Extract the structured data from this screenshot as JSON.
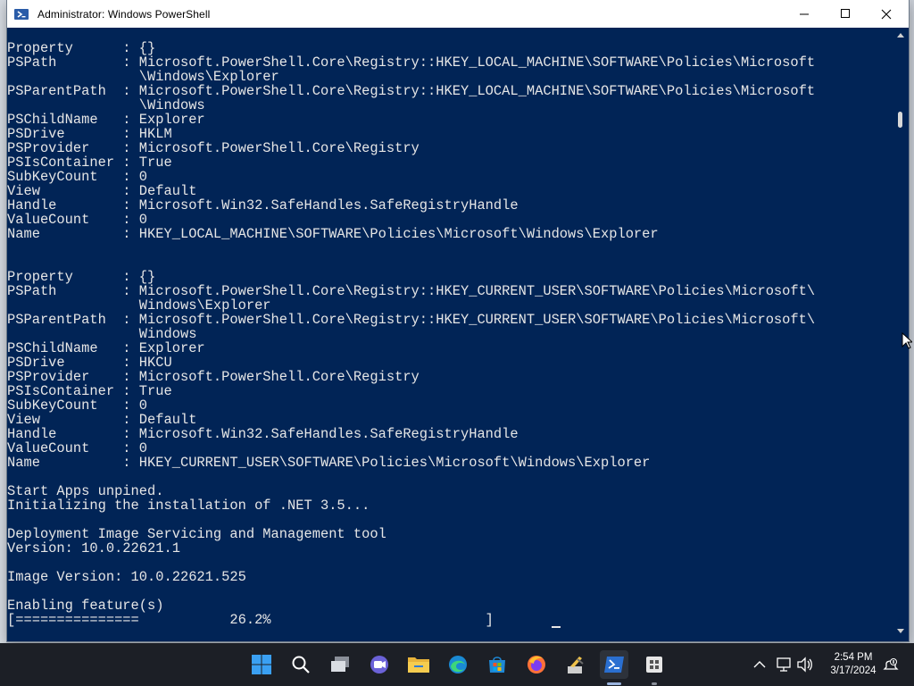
{
  "window": {
    "title": "Administrator: Windows PowerShell",
    "minimize_label": "minimize",
    "maximize_label": "maximize",
    "close_label": "close"
  },
  "console": {
    "lines": [
      "Property      : {}",
      "PSPath        : Microsoft.PowerShell.Core\\Registry::HKEY_LOCAL_MACHINE\\SOFTWARE\\Policies\\Microsoft",
      "                \\Windows\\Explorer",
      "PSParentPath  : Microsoft.PowerShell.Core\\Registry::HKEY_LOCAL_MACHINE\\SOFTWARE\\Policies\\Microsoft",
      "                \\Windows",
      "PSChildName   : Explorer",
      "PSDrive       : HKLM",
      "PSProvider    : Microsoft.PowerShell.Core\\Registry",
      "PSIsContainer : True",
      "SubKeyCount   : 0",
      "View          : Default",
      "Handle        : Microsoft.Win32.SafeHandles.SafeRegistryHandle",
      "ValueCount    : 0",
      "Name          : HKEY_LOCAL_MACHINE\\SOFTWARE\\Policies\\Microsoft\\Windows\\Explorer",
      "",
      "",
      "Property      : {}",
      "PSPath        : Microsoft.PowerShell.Core\\Registry::HKEY_CURRENT_USER\\SOFTWARE\\Policies\\Microsoft\\",
      "                Windows\\Explorer",
      "PSParentPath  : Microsoft.PowerShell.Core\\Registry::HKEY_CURRENT_USER\\SOFTWARE\\Policies\\Microsoft\\",
      "                Windows",
      "PSChildName   : Explorer",
      "PSDrive       : HKCU",
      "PSProvider    : Microsoft.PowerShell.Core\\Registry",
      "PSIsContainer : True",
      "SubKeyCount   : 0",
      "View          : Default",
      "Handle        : Microsoft.Win32.SafeHandles.SafeRegistryHandle",
      "ValueCount    : 0",
      "Name          : HKEY_CURRENT_USER\\SOFTWARE\\Policies\\Microsoft\\Windows\\Explorer",
      "",
      "Start Apps unpined.",
      "Initializing the installation of .NET 3.5...",
      "",
      "Deployment Image Servicing and Management tool",
      "Version: 10.0.22621.1",
      "",
      "Image Version: 10.0.22621.525",
      "",
      "Enabling feature(s)",
      "[===============           26.2%                          ] "
    ],
    "progress_percent": 26.2
  },
  "taskbar": {
    "apps": [
      {
        "name": "start-icon"
      },
      {
        "name": "search-icon"
      },
      {
        "name": "task-view-icon"
      },
      {
        "name": "chat-icon"
      },
      {
        "name": "file-explorer-icon"
      },
      {
        "name": "edge-icon"
      },
      {
        "name": "store-icon"
      },
      {
        "name": "firefox-icon"
      },
      {
        "name": "winget-tool-icon"
      },
      {
        "name": "powershell-icon"
      },
      {
        "name": "app-grid-icon"
      }
    ],
    "tray": {
      "time": "2:54 PM",
      "date": "3/17/2024"
    }
  },
  "colors": {
    "console_bg": "#012456",
    "console_fg": "#e6e6e6",
    "taskbar_bg": "#1c1f26"
  }
}
